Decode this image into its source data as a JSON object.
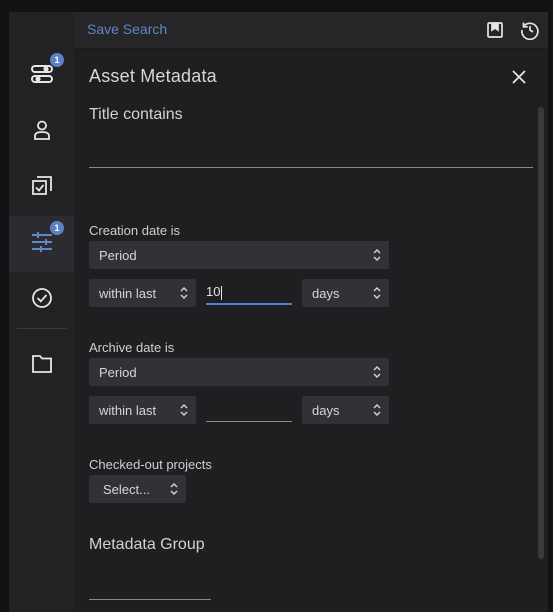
{
  "toolbar": {
    "save_search_label": "Save Search",
    "icons": [
      "bookmark-icon",
      "history-icon"
    ]
  },
  "rail": {
    "items": [
      {
        "name": "toggles-icon",
        "badge": "1"
      },
      {
        "name": "user-icon"
      },
      {
        "name": "copy-check-icon"
      },
      {
        "name": "filter-sliders-icon",
        "badge": "1",
        "active": true
      },
      {
        "name": "check-circle-icon"
      },
      {
        "name": "folder-icon"
      }
    ]
  },
  "panel": {
    "title": "Asset Metadata",
    "title_contains": {
      "label": "Title contains",
      "value": ""
    },
    "creation_date": {
      "label": "Creation date is",
      "mode": "Period",
      "relation": "within last",
      "amount": "10",
      "unit": "days"
    },
    "archive_date": {
      "label": "Archive date is",
      "mode": "Period",
      "relation": "within last",
      "amount": "",
      "unit": "days"
    },
    "checked_out": {
      "label": "Checked-out projects",
      "placeholder": "Select..."
    },
    "metadata_group": {
      "label": "Metadata Group",
      "value": ""
    }
  },
  "colors": {
    "accent": "#5f86c6",
    "focus": "#4f7fd0",
    "badge": "#5b82c8"
  }
}
